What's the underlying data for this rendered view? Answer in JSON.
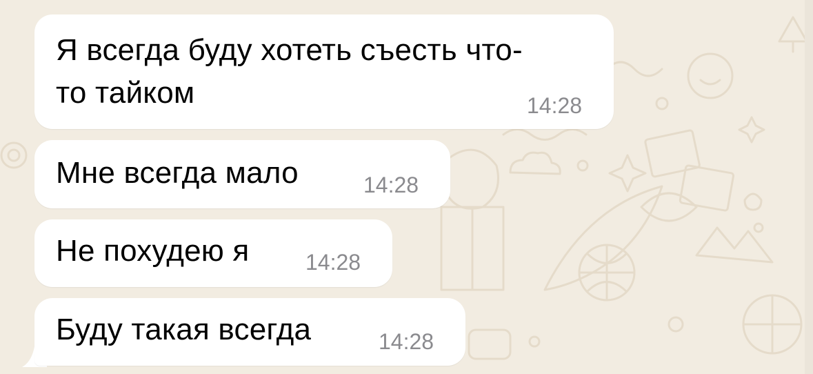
{
  "chat": {
    "messages": [
      {
        "text": "Я всегда буду хотеть съесть что-то тайком",
        "line1": "Я всегда буду хотеть съесть что-",
        "line2": "то тайком",
        "time": "14:28"
      },
      {
        "text": "Мне всегда мало",
        "time": "14:28"
      },
      {
        "text": "Не похудею я",
        "time": "14:28"
      },
      {
        "text": "Буду такая всегда",
        "time": "14:28"
      }
    ]
  },
  "colors": {
    "background": "#f2ece1",
    "bubble": "#ffffff",
    "text": "#000000",
    "time": "#8a8a8e",
    "doodle": "#e6dccb"
  }
}
